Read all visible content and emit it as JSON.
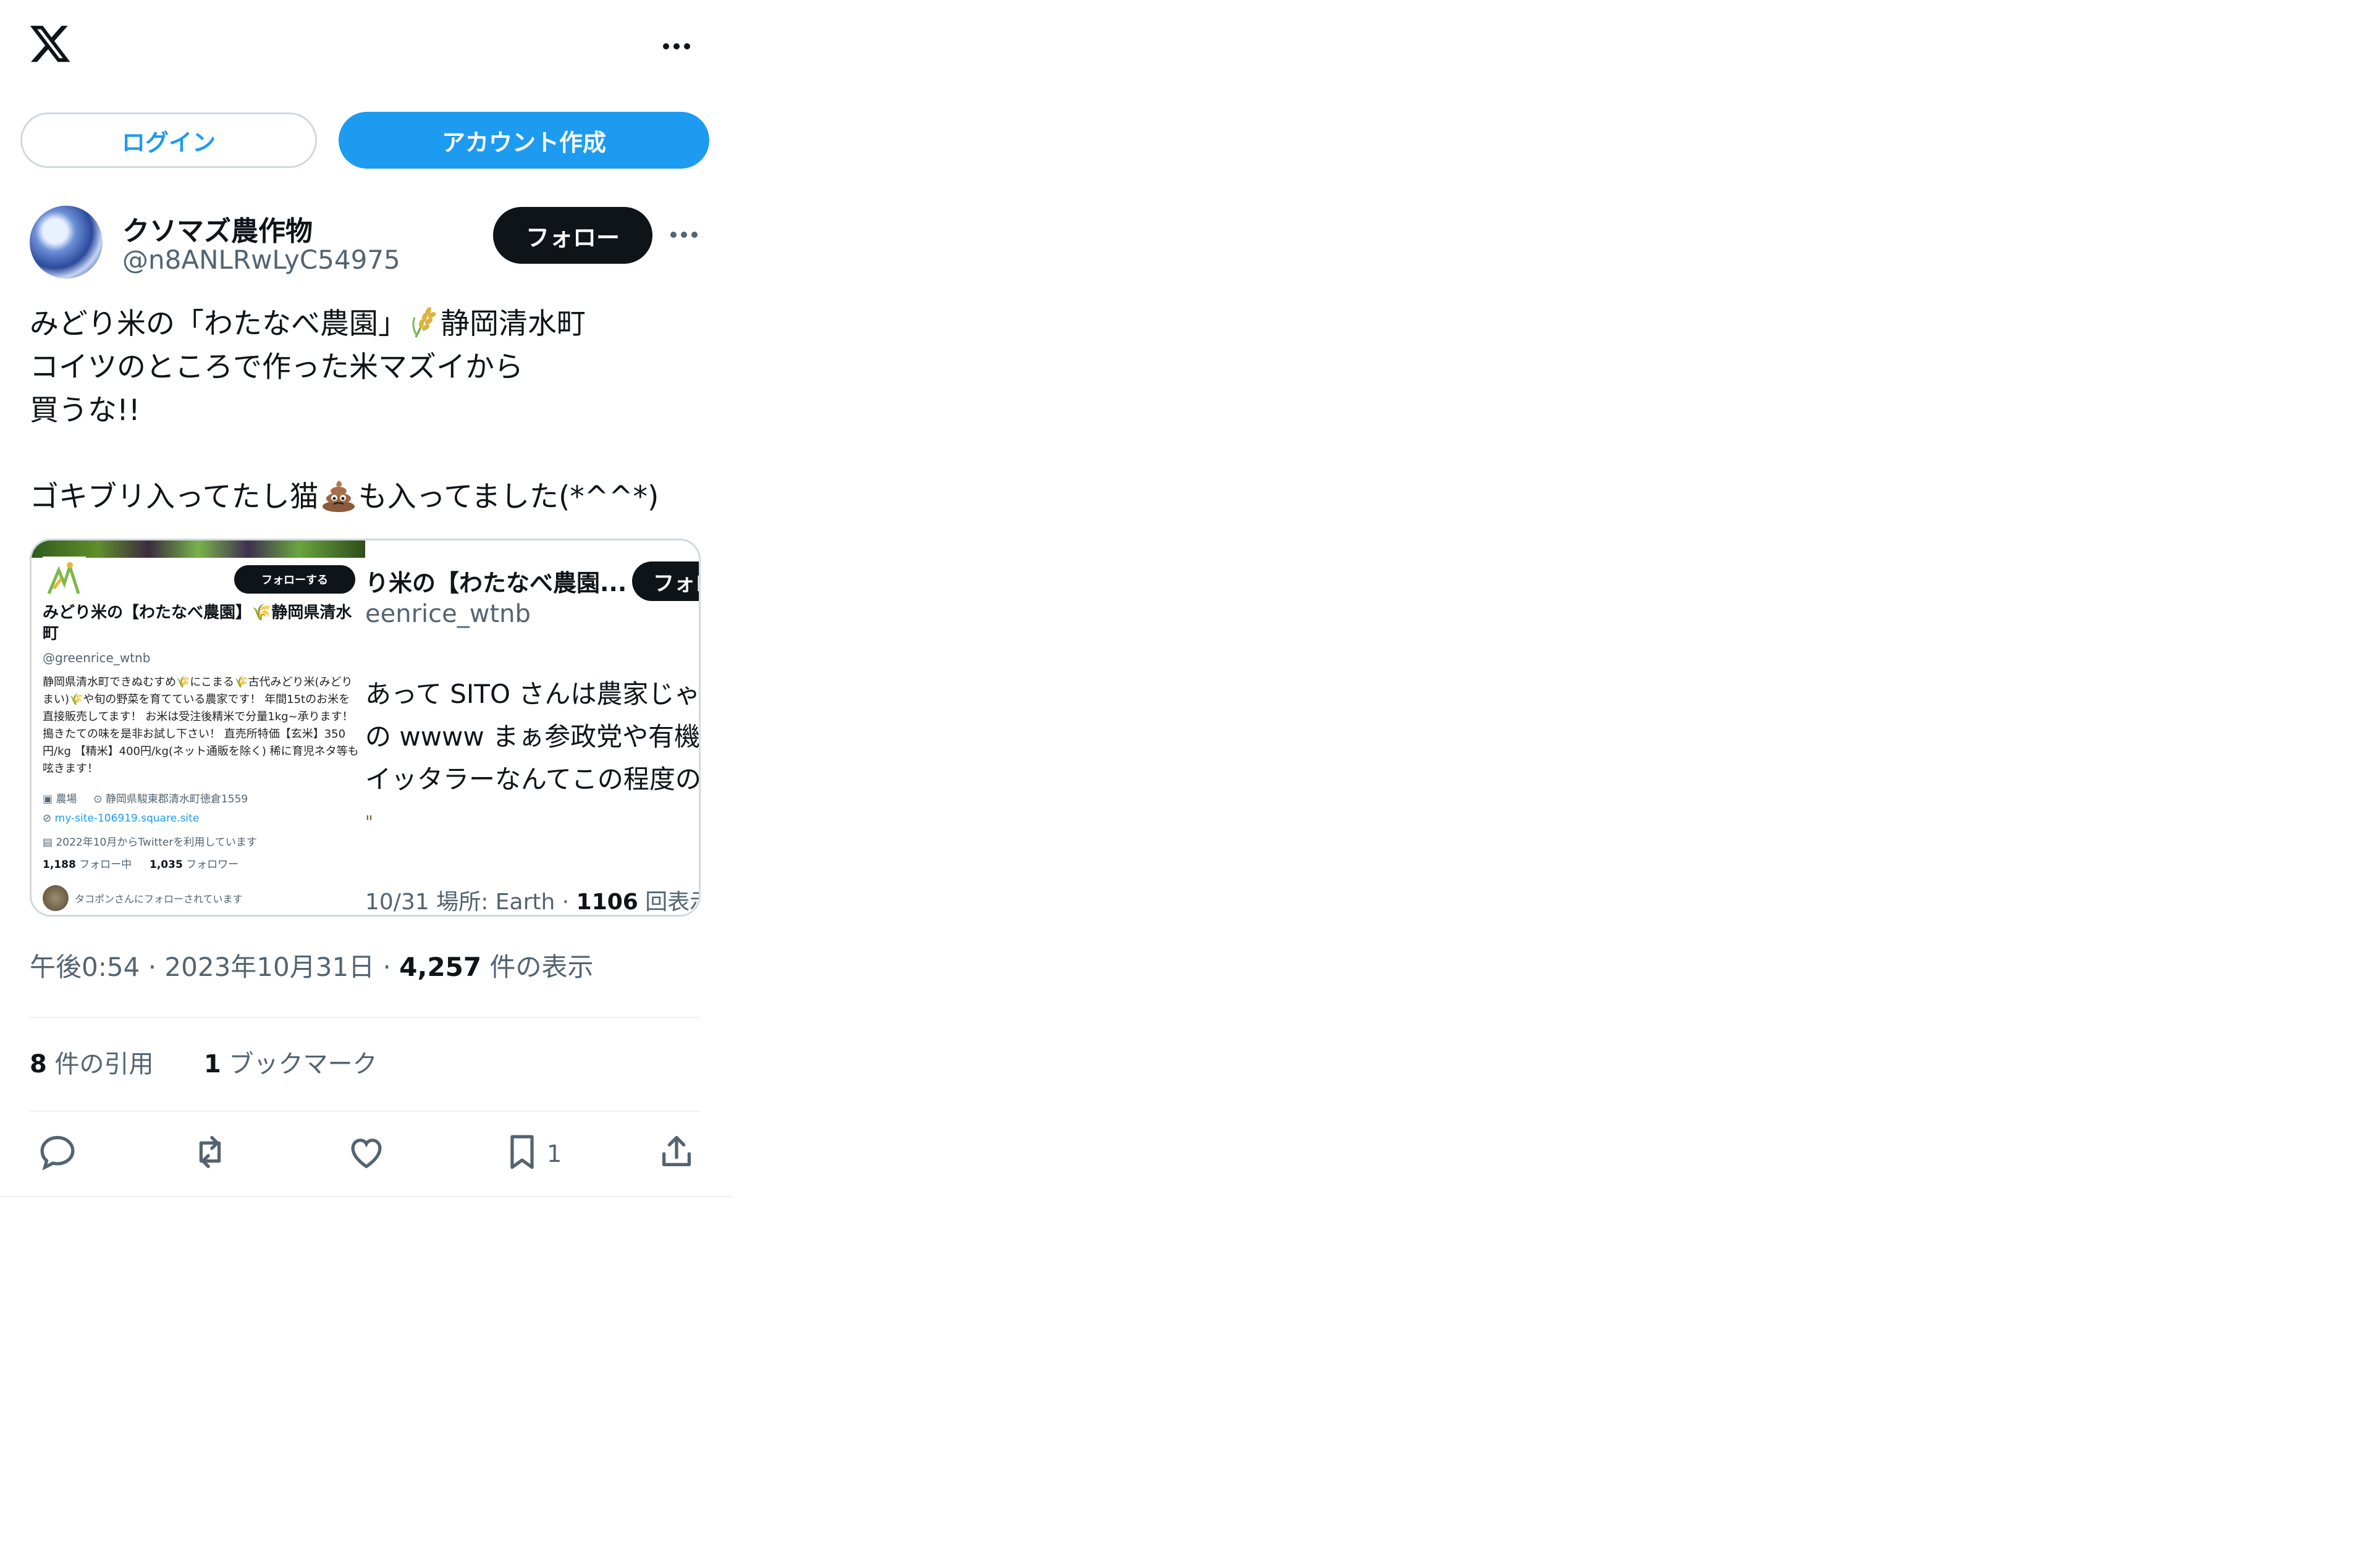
{
  "header": {
    "logo_icon": "x-logo-icon",
    "more_icon": "more-horizontal-icon",
    "login_label": "ログイン",
    "signup_label": "アカウント作成"
  },
  "author": {
    "name": "クソマズ農作物",
    "handle": "@n8ANLRwLyC54975",
    "follow_label": "フォロー"
  },
  "tweet": {
    "lines": [
      {
        "before": "みどり米の「わたなべ農園」",
        "emoji": "rice-emoji",
        "after": "静岡清水町"
      },
      {
        "text": "コイツのところで作った米マズイから"
      },
      {
        "text": "買うな!!"
      },
      {
        "text": ""
      },
      {
        "before": "ゴキブリ入ってたし猫",
        "emoji": "poo-emoji",
        "after": "も入ってました(*^^*)"
      }
    ]
  },
  "media": {
    "left": {
      "follow_label": "フォローする",
      "name": "みどり米の【わたなべ農園】🌾静岡県清水町",
      "handle": "@greenrice_wtnb",
      "bio": "静岡県清水町できぬむすめ🌾にこまる🌾古代みどり米(みどりまい)🌾や旬の野菜を育てている農家です！ 年間15tのお米を直接販売してます！ お米は受注後精米で分量1kg~承ります！搗きたての味を是非お試し下さい！ 直売所特価【玄米】350円/kg 【精米】400円/kg(ネット通販を除く) 稀に育児ネタ等も呟きます！",
      "category": "農場",
      "location": "静岡県駿東郡清水町徳倉1559",
      "link": "my-site-106919.square.site",
      "joined": "2022年10月からTwitterを利用しています",
      "following_count": "1,188",
      "following_label": "フォロー中",
      "followers_count": "1,035",
      "followers_label": "フォロワー",
      "followed_by": "タコポンさんにフォローされています"
    },
    "right": {
      "name": "り米の【わたなべ農園...",
      "follow_label": "フォロ",
      "handle": "eenrice_wtnb",
      "lines": [
        "あって SITO さんは農家じゃ",
        "の wwww まぁ参政党や有機",
        "イッタラーなんてこの程度の",
        "\""
      ],
      "footer_date": "10/31 場所: Earth · ",
      "footer_views": "1106",
      "footer_views_label": " 回表示"
    }
  },
  "meta": {
    "time": "午後0:54",
    "date": "2023年10月31日",
    "views": "4,257",
    "views_label": " 件の表示"
  },
  "engagement": {
    "quotes_count": "8",
    "quotes_label": " 件の引用",
    "bookmarks_count": "1",
    "bookmarks_label": " ブックマーク"
  },
  "actions": {
    "reply_icon": "reply-icon",
    "retweet_icon": "retweet-icon",
    "like_icon": "like-icon",
    "bookmark_icon": "bookmark-icon",
    "bookmark_count": "1",
    "share_icon": "share-icon"
  },
  "colors": {
    "accent": "#1d9bf0",
    "text": "#0f1419",
    "secondary": "#536471",
    "border": "#cfd9de"
  }
}
